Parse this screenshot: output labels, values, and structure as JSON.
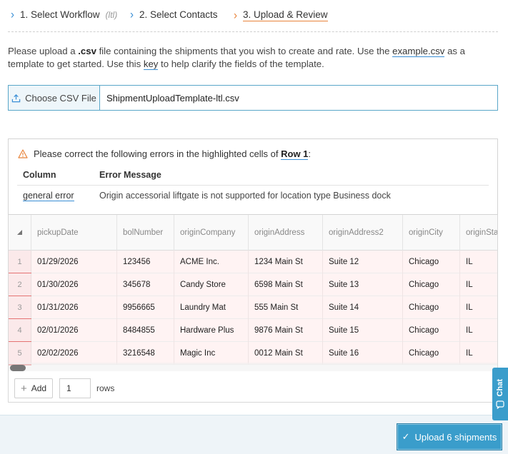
{
  "stepper": {
    "steps": [
      {
        "label": "1. Select Workflow",
        "note": "(ltl)"
      },
      {
        "label": "2. Select Contacts"
      },
      {
        "label": "3. Upload & Review"
      }
    ]
  },
  "instructions": {
    "part1": "Please upload a ",
    "ext": ".csv",
    "part2": " file containing the shipments that you wish to create and rate. Use the ",
    "example_link": "example.csv",
    "part3": " as a template to get started. Use this ",
    "key_link": "key",
    "part4": " to help clarify the fields of the template."
  },
  "file_picker": {
    "button_label": "Choose CSV File",
    "file_name": "ShipmentUploadTemplate-ltl.csv"
  },
  "errors": {
    "message_prefix": "Please correct the following errors in the highlighted cells of ",
    "row_ref": "Row 1",
    "message_suffix": ":",
    "col_header": "Column",
    "msg_header": "Error Message",
    "items": [
      {
        "column": "general error",
        "message": "Origin accessorial liftgate is not supported for location type Business dock"
      }
    ]
  },
  "grid": {
    "columns": [
      "pickupDate",
      "bolNumber",
      "originCompany",
      "originAddress",
      "originAddress2",
      "originCity",
      "originState"
    ],
    "rows": [
      {
        "n": "1",
        "cells": [
          "01/29/2026",
          "123456",
          "ACME Inc.",
          "1234 Main St",
          "Suite 12",
          "Chicago",
          "IL"
        ]
      },
      {
        "n": "2",
        "cells": [
          "01/30/2026",
          "345678",
          "Candy Store",
          "6598 Main St",
          "Suite 13",
          "Chicago",
          "IL"
        ]
      },
      {
        "n": "3",
        "cells": [
          "01/31/2026",
          "9956665",
          "Laundry Mat",
          "555 Main St",
          "Suite 14",
          "Chicago",
          "IL"
        ]
      },
      {
        "n": "4",
        "cells": [
          "02/01/2026",
          "8484855",
          "Hardware Plus",
          "9876 Main St",
          "Suite 15",
          "Chicago",
          "IL"
        ]
      },
      {
        "n": "5",
        "cells": [
          "02/02/2026",
          "3216548",
          "Magic Inc",
          "0012 Main St",
          "Suite 16",
          "Chicago",
          "IL"
        ]
      }
    ]
  },
  "add_rows": {
    "button_label": "Add",
    "count_value": "1",
    "suffix": "rows"
  },
  "footer": {
    "upload_label": "Upload 6 shipments"
  },
  "chat": {
    "label": "Chat"
  },
  "colors": {
    "accent": "#3a9dcb",
    "active_step": "#e8833a",
    "error_row": "#fff3f3",
    "error_marker": "#e57373"
  }
}
